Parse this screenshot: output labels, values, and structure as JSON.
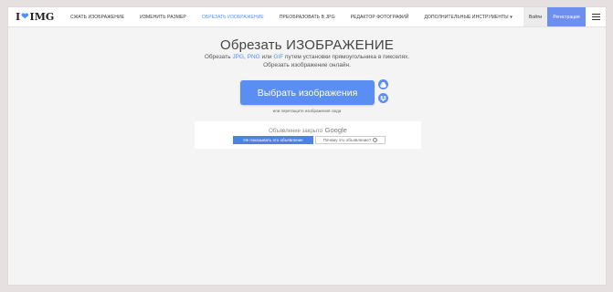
{
  "logo": {
    "left": "I",
    "right": "IMG"
  },
  "nav": {
    "items": [
      {
        "label": "Сжать ИЗОБРАЖЕНИЕ",
        "active": false
      },
      {
        "label": "Изменить размер",
        "active": false
      },
      {
        "label": "Обрезать ИЗОБРАЖЕНИЕ",
        "active": true
      },
      {
        "label": "Преобразовать в JPG",
        "active": false
      },
      {
        "label": "Редактор фотографий",
        "active": false
      },
      {
        "label": "Дополнительные инструменты ▾",
        "active": false
      }
    ],
    "login": "Войти",
    "register": "Регистрация"
  },
  "main": {
    "title": "Обрезать ИЗОБРАЖЕНИЕ",
    "subtitle_prefix": "Обрезать ",
    "fmt_jpg": "JPG",
    "fmt_sep1": ", ",
    "fmt_png": "PNG",
    "fmt_or": " или ",
    "fmt_gif": "GIF",
    "subtitle_suffix": " путем установки прямоугольника в пикселях.",
    "subtitle_line2": "Обрезать изображение онлайн.",
    "select_button": "Выбрать изображения",
    "drop_hint": "или перетащите изображения сюда"
  },
  "ad": {
    "closed_text": "Объявление закрыто",
    "google": "Google",
    "stop_button": "Не показывать это объявление",
    "why_button": "Почему это объявление?",
    "why_icon": "i"
  },
  "colors": {
    "accent": "#4d90fe",
    "button": "#5b8ef2",
    "register": "#6c8ff0"
  }
}
